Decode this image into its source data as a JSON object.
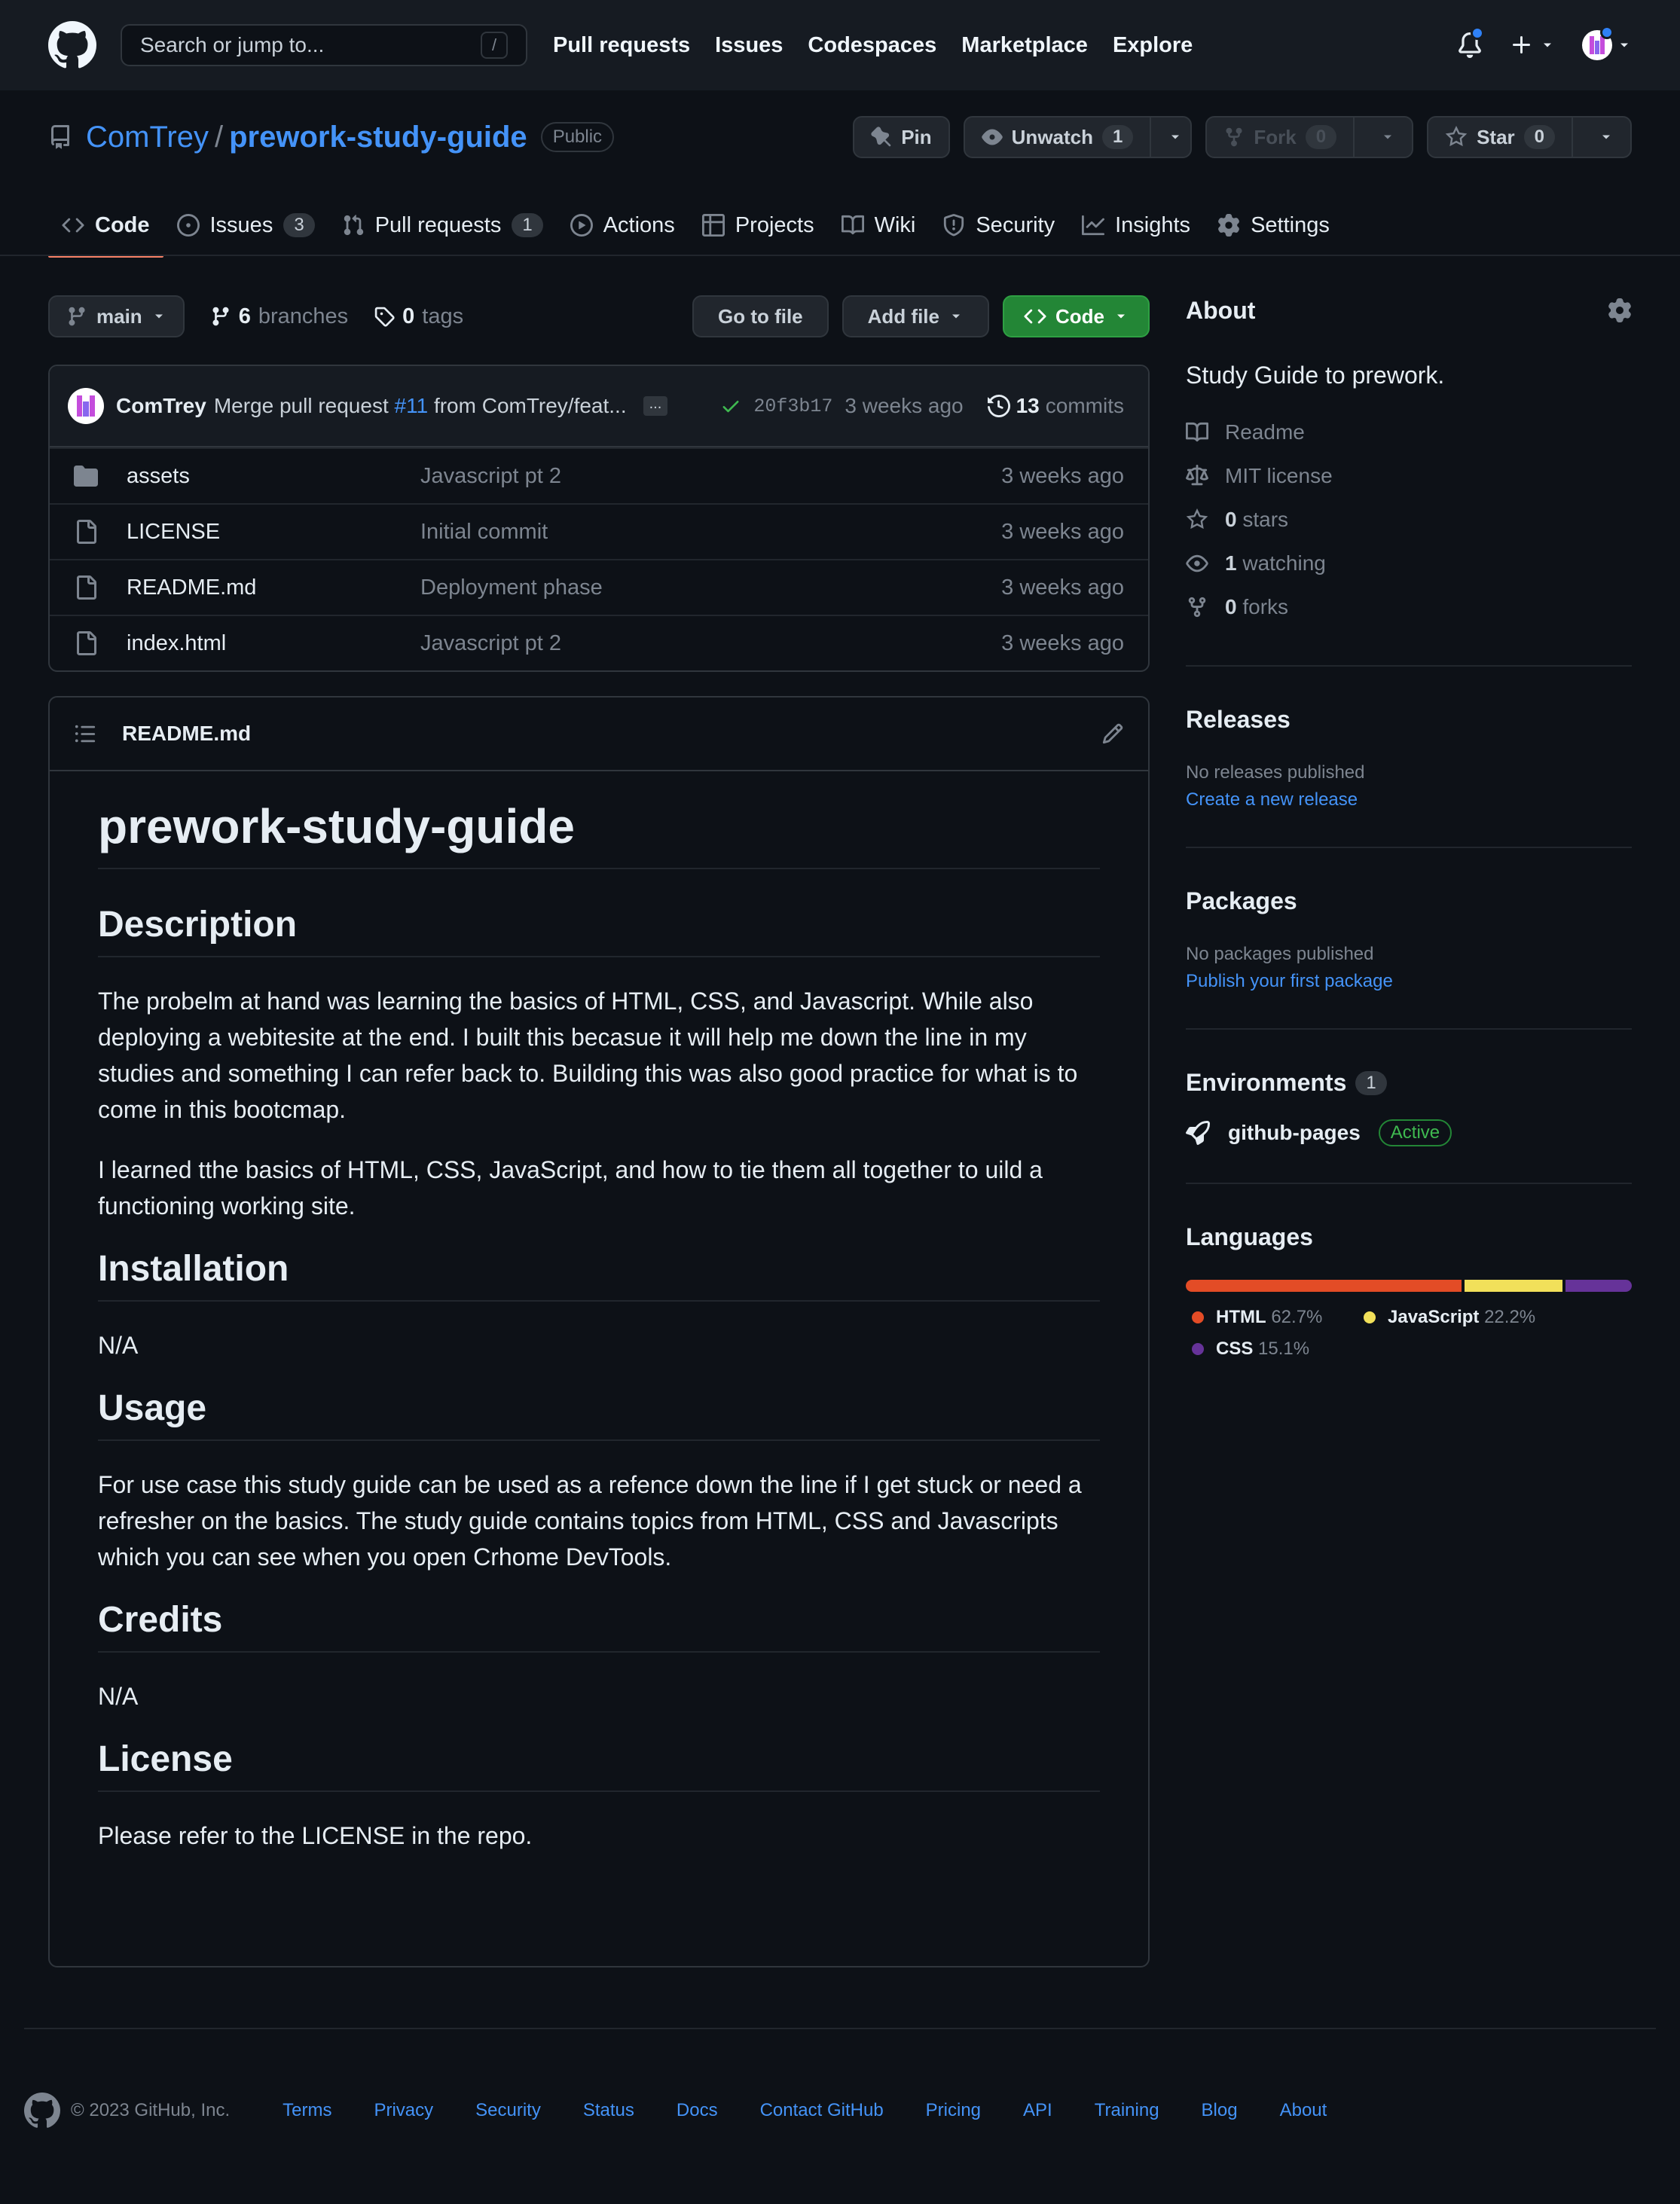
{
  "header": {
    "search_placeholder": "Search or jump to...",
    "search_key": "/",
    "nav": [
      "Pull requests",
      "Issues",
      "Codespaces",
      "Marketplace",
      "Explore"
    ]
  },
  "repo": {
    "owner": "ComTrey",
    "name": "prework-study-guide",
    "visibility": "Public",
    "pin_label": "Pin",
    "unwatch_label": "Unwatch",
    "watch_count": "1",
    "fork_label": "Fork",
    "fork_count": "0",
    "star_label": "Star",
    "star_count": "0"
  },
  "tabs": [
    {
      "label": "Code",
      "count": ""
    },
    {
      "label": "Issues",
      "count": "3"
    },
    {
      "label": "Pull requests",
      "count": "1"
    },
    {
      "label": "Actions",
      "count": ""
    },
    {
      "label": "Projects",
      "count": ""
    },
    {
      "label": "Wiki",
      "count": ""
    },
    {
      "label": "Security",
      "count": ""
    },
    {
      "label": "Insights",
      "count": ""
    },
    {
      "label": "Settings",
      "count": ""
    }
  ],
  "toolbar": {
    "branch": "main",
    "branches_count": "6",
    "branches_label": "branches",
    "tags_count": "0",
    "tags_label": "tags",
    "goto_label": "Go to file",
    "addfile_label": "Add file",
    "code_label": "Code"
  },
  "commit": {
    "author": "ComTrey",
    "msg_prefix": "Merge pull request",
    "pr_link": "#11",
    "msg_suffix": "from ComTrey/feat...",
    "ellipsis": "...",
    "sha": "20f3b17",
    "time": "3 weeks ago",
    "commits_count": "13",
    "commits_label": "commits"
  },
  "files": [
    {
      "type": "folder",
      "name": "assets",
      "message": "Javascript pt 2",
      "time": "3 weeks ago"
    },
    {
      "type": "file",
      "name": "LICENSE",
      "message": "Initial commit",
      "time": "3 weeks ago"
    },
    {
      "type": "file",
      "name": "README.md",
      "message": "Deployment phase",
      "time": "3 weeks ago"
    },
    {
      "type": "file",
      "name": "index.html",
      "message": "Javascript pt 2",
      "time": "3 weeks ago"
    }
  ],
  "readme": {
    "filename": "README.md",
    "title": "prework-study-guide",
    "sections": {
      "description_h": "Description",
      "description_p1": "The probelm at hand was learning the basics of HTML, CSS, and Javascript. While also deploying a webitesite at the end. I built this becasue it will help me down the line in my studies and something I can refer back to. Building this was also good practice for what is to come in this bootcmap.",
      "description_p2": "I learned tthe basics of HTML, CSS, JavaScript, and how to tie them all together to uild a functioning working site.",
      "installation_h": "Installation",
      "installation_p": "N/A",
      "usage_h": "Usage",
      "usage_p": "For use case this study guide can be used as a refence down the line if I get stuck or need a refresher on the basics. The study guide contains topics from HTML, CSS and Javascripts which you can see when you open Crhome DevTools.",
      "credits_h": "Credits",
      "credits_p": "N/A",
      "license_h": "License",
      "license_p": "Please refer to the LICENSE in the repo."
    }
  },
  "sidebar": {
    "about_title": "About",
    "description": "Study Guide to prework.",
    "readme": "Readme",
    "license": "MIT license",
    "stars_count": "0",
    "stars_label": "stars",
    "watching_count": "1",
    "watching_label": "watching",
    "forks_count": "0",
    "forks_label": "forks",
    "releases_title": "Releases",
    "releases_none": "No releases published",
    "releases_link": "Create a new release",
    "packages_title": "Packages",
    "packages_none": "No packages published",
    "packages_link": "Publish your first package",
    "environments_title": "Environments",
    "environments_count": "1",
    "env_name": "github-pages",
    "env_status": "Active",
    "languages_title": "Languages",
    "languages": [
      {
        "name": "HTML",
        "percent": "62.7%",
        "value": 62.7,
        "color": "#e34c26"
      },
      {
        "name": "JavaScript",
        "percent": "22.2%",
        "value": 22.2,
        "color": "#f1e05a"
      },
      {
        "name": "CSS",
        "percent": "15.1%",
        "value": 15.1,
        "color": "#663399"
      }
    ]
  },
  "footer": {
    "copyright": "© 2023 GitHub, Inc.",
    "links": [
      "Terms",
      "Privacy",
      "Security",
      "Status",
      "Docs",
      "Contact GitHub",
      "Pricing",
      "API",
      "Training",
      "Blog",
      "About"
    ]
  }
}
